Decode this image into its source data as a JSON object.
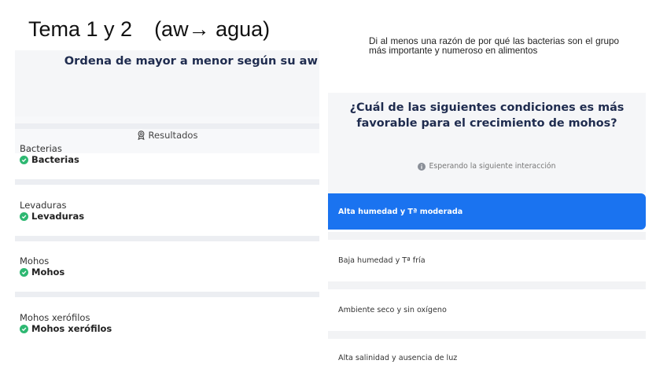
{
  "slide": {
    "title_left": "Tema 1 y 2",
    "title_right": "(aw→ agua)"
  },
  "left": {
    "question": "Ordena de mayor a menor según su aw",
    "results_label": "Resultados",
    "items": [
      {
        "label": "Bacterias",
        "answer": "Bacterias"
      },
      {
        "label": "Levaduras",
        "answer": "Levaduras"
      },
      {
        "label": "Mohos",
        "answer": "Mohos"
      },
      {
        "label": "Mohos xerófilos",
        "answer": "Mohos xerófilos"
      }
    ]
  },
  "right": {
    "prompt": "Di al menos una razón de por qué las bacterias son el grupo más importante y numeroso en alimentos",
    "question": "¿Cuál de las siguientes condiciones es más favorable para el crecimiento de mohos?",
    "waiting": "Esperando la siguiente interacción",
    "options": [
      {
        "label": "Alta humedad y Tª moderada",
        "selected": true
      },
      {
        "label": "Baja humedad y Tª fría",
        "selected": false
      },
      {
        "label": "Ambiente seco y sin oxígeno",
        "selected": false
      },
      {
        "label": "Alta salinidad y ausencia de luz",
        "selected": false
      }
    ]
  },
  "colors": {
    "accent": "#1a73f0",
    "success": "#2eb872",
    "heading": "#1f2c4f"
  },
  "icons": {
    "results": "award-ribbon-icon",
    "correct": "check-circle-icon",
    "waiting": "info-circle-icon"
  }
}
